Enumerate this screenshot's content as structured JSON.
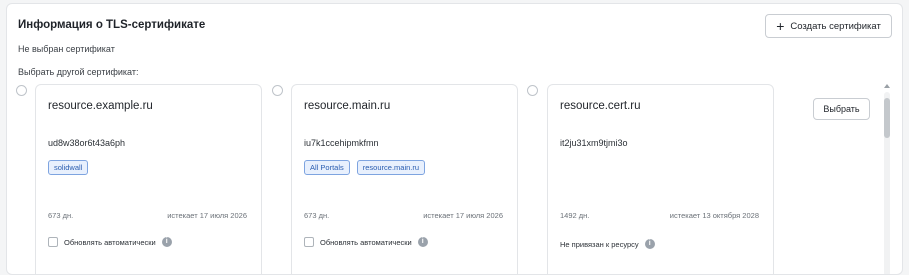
{
  "section": {
    "title": "Информация о TLS-сертификате",
    "create_button_label": "Создать сертификат",
    "no_certificate_text": "Не выбран сертификат",
    "choose_other_label": "Выбрать другой сертификат:",
    "select_button_label": "Выбрать"
  },
  "certificates": [
    {
      "name": "resource.example.ru",
      "id": "ud8w38or6t43a6ph",
      "tags": [
        "solidwall"
      ],
      "days": "673 дн.",
      "expires": "истекает 17 июля 2026",
      "footer_text": "Обновлять автоматически",
      "footer_has_checkbox": true
    },
    {
      "name": "resource.main.ru",
      "id": "iu7k1ccehipmkfmn",
      "tags": [
        "All Portals",
        "resource.main.ru"
      ],
      "days": "673 дн.",
      "expires": "истекает 17 июля 2026",
      "footer_text": "Обновлять автоматически",
      "footer_has_checkbox": true
    },
    {
      "name": "resource.cert.ru",
      "id": "it2ju31xm9tjmi3o",
      "tags": [],
      "days": "1492 дн.",
      "expires": "истекает 13 октября 2028",
      "footer_text": "Не привязан к ресурсу",
      "footer_has_checkbox": false
    }
  ],
  "icons": {
    "plus": "plus-icon",
    "info": "info-icon",
    "scroll_up": "chevron-up-icon"
  },
  "colors": {
    "tag_text": "#2a5db0",
    "tag_bg": "#e8f0fd",
    "tag_border": "#7ea4e0",
    "border": "#e3e5e8"
  }
}
